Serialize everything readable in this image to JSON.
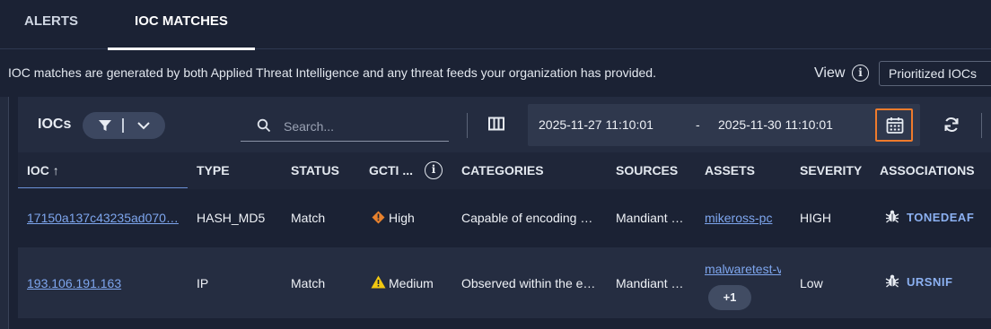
{
  "tabs": [
    {
      "label": "ALERTS",
      "active": false
    },
    {
      "label": "IOC MATCHES",
      "active": true
    }
  ],
  "info_text": "IOC matches are generated by both Applied Threat Intelligence and any threat feeds your organization has provided.",
  "view": {
    "label": "View",
    "selected": "Prioritized IOCs"
  },
  "toolbar": {
    "title": "IOCs",
    "search_placeholder": "Search...",
    "date_start": "2025-11-27 11:10:01",
    "date_separator": "-",
    "date_end": "2025-11-30 11:10:01"
  },
  "columns": [
    "IOC ↑",
    "TYPE",
    "STATUS",
    "GCTI ...",
    "CATEGORIES",
    "SOURCES",
    "ASSETS",
    "SEVERITY",
    "ASSOCIATIONS"
  ],
  "rows": [
    {
      "ioc": "17150a137c43235ad070…",
      "type": "HASH_MD5",
      "status": "Match",
      "gcti": "High",
      "categories": "Capable of encoding …",
      "sources": "Mandiant …",
      "asset": "mikeross-pc",
      "severity": "HIGH",
      "association": "TONEDEAF"
    },
    {
      "ioc": "193.106.191.163",
      "type": "IP",
      "status": "Match",
      "gcti": "Medium",
      "categories": "Observed within the e…",
      "sources": "Mandiant …",
      "asset": "malwaretest-v",
      "asset_more": "+1",
      "severity": "Low",
      "association": "URSNIF"
    }
  ],
  "colors": {
    "background": "#1b2234",
    "accent_orange": "#ef7b2c",
    "link_blue": "#7ea6ee",
    "warn_high": "#e8812d",
    "warn_medium": "#f2c811"
  }
}
